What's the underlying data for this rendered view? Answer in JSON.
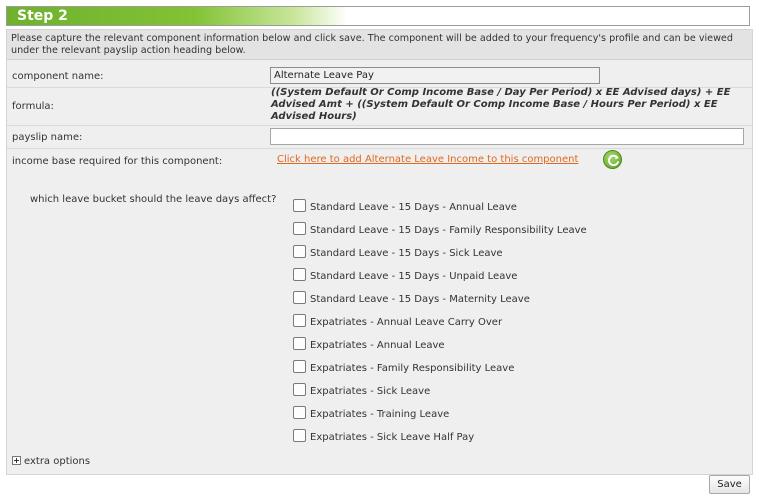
{
  "step": {
    "title": "Step 2"
  },
  "intro": {
    "text": "Please capture the relevant component information below and click save. The component will be added to your frequency's profile and can be viewed under the relevant payslip action heading below."
  },
  "form": {
    "component_name_label": "component name:",
    "component_name_value": "Alternate Leave Pay",
    "formula_label": "formula:",
    "formula_value": "((System Default Or Comp Income Base / Day Per Period) x EE Advised days) + EE Advised Amt + ((System Default Or Comp Income Base / Hours Per Period) x EE Advised Hours)",
    "payslip_name_label": "payslip name:",
    "payslip_name_value": "",
    "income_base_label": "income base required for this component:",
    "income_base_link": "Click here to add Alternate Leave Income to this component",
    "refresh_icon": "refresh-icon"
  },
  "leave": {
    "question": "which leave bucket should the leave days affect?",
    "buckets": [
      {
        "label": "Standard Leave - 15 Days - Annual Leave",
        "checked": false
      },
      {
        "label": "Standard Leave - 15 Days - Family Responsibility Leave",
        "checked": false
      },
      {
        "label": "Standard Leave - 15 Days - Sick Leave",
        "checked": false
      },
      {
        "label": "Standard Leave - 15 Days - Unpaid Leave",
        "checked": false
      },
      {
        "label": "Standard Leave - 15 Days - Maternity Leave",
        "checked": false
      },
      {
        "label": "Expatriates - Annual Leave Carry Over",
        "checked": false
      },
      {
        "label": "Expatriates - Annual Leave",
        "checked": false
      },
      {
        "label": "Expatriates - Family Responsibility Leave",
        "checked": false
      },
      {
        "label": "Expatriates - Sick Leave",
        "checked": false
      },
      {
        "label": "Expatriates - Training Leave",
        "checked": false
      },
      {
        "label": "Expatriates - Sick Leave Half Pay",
        "checked": false
      }
    ]
  },
  "extra_options": {
    "label": "extra options",
    "icon": "expand-plus-icon"
  },
  "actions": {
    "save_label": "Save"
  },
  "colors": {
    "header_green": "#6eb12e",
    "link_orange": "#e2671f",
    "panel_bg": "#efefef"
  }
}
